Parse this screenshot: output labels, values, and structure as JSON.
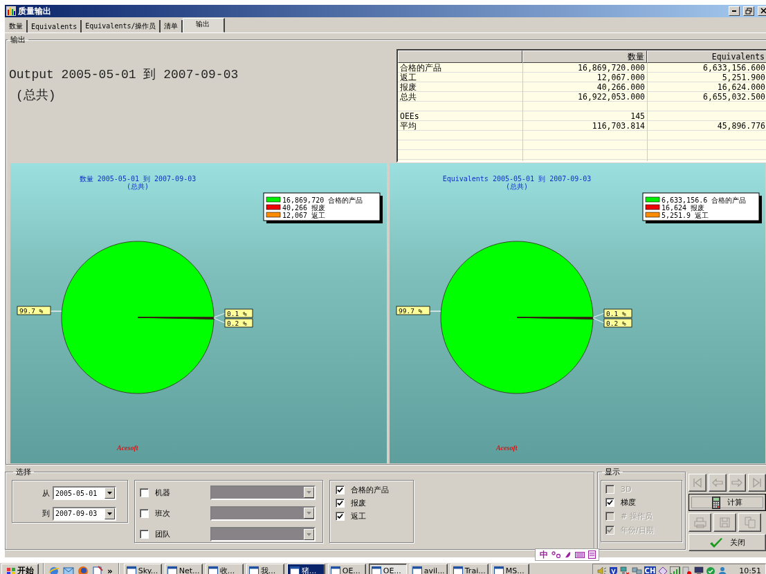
{
  "window": {
    "title": "质量输出"
  },
  "tabs": [
    {
      "label": "数量",
      "selected": false
    },
    {
      "label": "Equivalents",
      "selected": false
    },
    {
      "label": "Equivalents/操作员",
      "selected": false
    },
    {
      "label": "清单",
      "selected": false
    },
    {
      "label": "输出",
      "selected": true
    }
  ],
  "output_group": {
    "title": "输出",
    "heading": {
      "title": "Output 2005-05-01 到 2007-09-03",
      "subtitle": "(总共)"
    },
    "table": {
      "columns": [
        "数量",
        "Equivalents"
      ],
      "rows": [
        {
          "kind": "data",
          "label": "合格的产品",
          "values": [
            "16,869,720.000",
            "6,633,156.600"
          ]
        },
        {
          "kind": "data",
          "label": "返工",
          "values": [
            "12,067.000",
            "5,251.900"
          ]
        },
        {
          "kind": "data",
          "label": "报废",
          "values": [
            "40,266.000",
            "16,624.000"
          ]
        },
        {
          "kind": "data",
          "label": "总共",
          "values": [
            "16,922,053.000",
            "6,655,032.500"
          ]
        },
        {
          "kind": "spacer"
        },
        {
          "kind": "data",
          "label": "OEEs",
          "values": [
            "145"
          ]
        },
        {
          "kind": "data",
          "label": "平均",
          "values": [
            "116,703.814",
            "45,896.776"
          ]
        }
      ]
    },
    "charts": [
      {
        "subtitle": "(总共)",
        "brand_text": "Acesoft",
        "legend": [
          {
            "value": "16,869,720",
            "color": "#00ee00"
          },
          {
            "value": "40,266",
            "color": "#ee0000"
          },
          {
            "value": "12,067",
            "color": "#ff8c00"
          }
        ],
        "chart_data": {
          "type": "pie",
          "title": "数量 2005-05-01 到 2007-09-03",
          "categories": [
            "合格的产品",
            "报废",
            "返工"
          ],
          "values": [
            99.7,
            0.2,
            0.1
          ],
          "colors": [
            "#00ff00",
            "#ee0000",
            "#ff8c00"
          ],
          "value_labels": [
            "99.7 %",
            "0.2 %",
            "0.1 %"
          ]
        }
      },
      {
        "subtitle": "(总共)",
        "brand_text": "Acesoft",
        "legend": [
          {
            "value": "6,633,156.6",
            "color": "#00ee00"
          },
          {
            "value": "16,624",
            "color": "#ee0000"
          },
          {
            "value": "5,251.9",
            "color": "#ff8c00"
          }
        ],
        "chart_data": {
          "type": "pie",
          "title": "Equivalents 2005-05-01 到 2007-09-03",
          "categories": [
            "合格的产品",
            "报废",
            "返工"
          ],
          "values": [
            99.7,
            0.2,
            0.1
          ],
          "colors": [
            "#00ff00",
            "#ee0000",
            "#ff8c00"
          ],
          "value_labels": [
            "99.7 %",
            "0.2 %",
            "0.1 %"
          ]
        }
      }
    ]
  },
  "selection": {
    "title": "选择",
    "from_label": "从",
    "from_value": "2005-05-01",
    "to_label": "到",
    "to_value": "2007-09-03",
    "filters": [
      {
        "label": "机器",
        "checked": false,
        "dropdown_disabled": true
      },
      {
        "label": "班次",
        "checked": false,
        "dropdown_disabled": true
      },
      {
        "label": "团队",
        "checked": false,
        "dropdown_disabled": true
      }
    ],
    "series": [
      {
        "label": "合格的产品",
        "checked": true
      },
      {
        "label": "报废",
        "checked": true
      },
      {
        "label": "返工",
        "checked": true
      }
    ]
  },
  "display": {
    "title": "显示",
    "options": [
      {
        "label": "3D",
        "checked": false,
        "disabled": true
      },
      {
        "label": "梯度",
        "checked": true,
        "disabled": false
      },
      {
        "label": "# 操作员",
        "checked": false,
        "disabled": true
      },
      {
        "label": "年份/日期",
        "checked": true,
        "disabled": true
      }
    ]
  },
  "buttons": {
    "navigation": [
      {
        "kind": "first",
        "disabled": true
      },
      {
        "kind": "previous",
        "disabled": true
      },
      {
        "kind": "next",
        "disabled": true
      },
      {
        "kind": "last",
        "disabled": true
      }
    ],
    "calculate": {
      "label": "计算"
    },
    "tools": [
      {
        "kind": "print",
        "disabled": true
      },
      {
        "kind": "save",
        "disabled": true
      },
      {
        "kind": "copy",
        "disabled": true
      }
    ],
    "close": {
      "label": "关闭"
    }
  },
  "ime_bar": {
    "mode": "中"
  },
  "taskbar": {
    "start": "开始",
    "overflow": "»",
    "tasks": [
      {
        "label": "Sky...",
        "selected": false,
        "flashing": false
      },
      {
        "label": "Net...",
        "selected": false,
        "flashing": false
      },
      {
        "label": "收...",
        "selected": false,
        "flashing": false
      },
      {
        "label": "我...",
        "selected": false,
        "flashing": false
      },
      {
        "label": "猪...",
        "selected": false,
        "flashing": true
      },
      {
        "label": "OE...",
        "selected": false,
        "flashing": false
      },
      {
        "label": "OE...",
        "selected": true,
        "flashing": false
      },
      {
        "label": "avil...",
        "selected": false,
        "flashing": false
      },
      {
        "label": "Trai...",
        "selected": false,
        "flashing": false
      },
      {
        "label": "MS...",
        "selected": false,
        "flashing": false
      }
    ],
    "language": "CH",
    "clock": "10:51"
  }
}
